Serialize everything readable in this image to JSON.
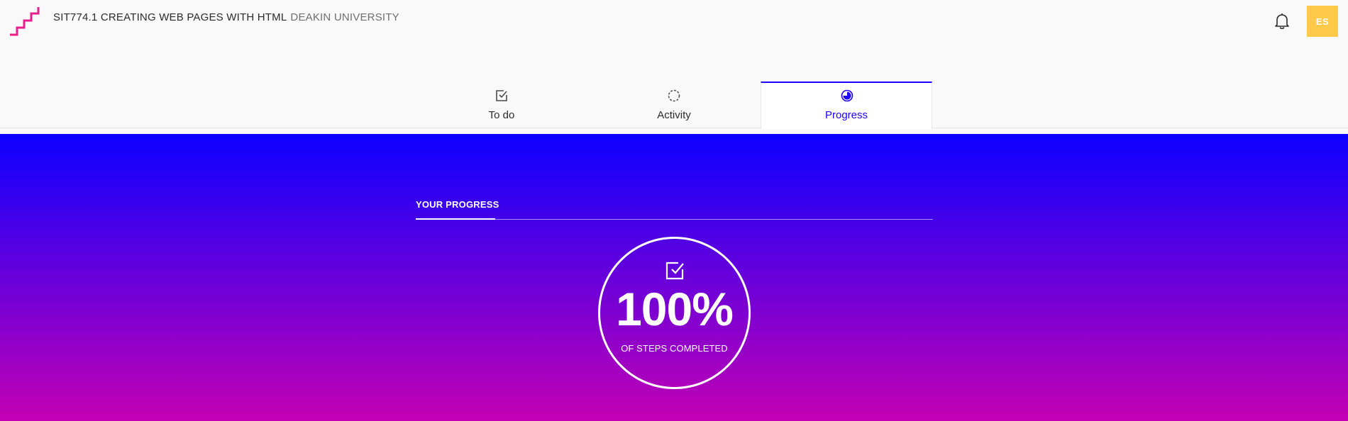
{
  "header": {
    "course_code_title": "SIT774.1 CREATING WEB PAGES WITH HTML",
    "university": "DEAKIN UNIVERSITY",
    "logo_icon": "staircase-logo-icon",
    "notification_icon": "bell-icon",
    "avatar_initials": "ES",
    "brand_color": "#e91e8c",
    "avatar_color": "#ffc94a"
  },
  "tabs": [
    {
      "label": "To do",
      "icon": "checkbox-icon",
      "active": false
    },
    {
      "label": "Activity",
      "icon": "dashed-circle-icon",
      "active": false
    },
    {
      "label": "Progress",
      "icon": "progress-circle-icon",
      "active": true
    }
  ],
  "accent_color": "#1d00ff",
  "progress": {
    "heading": "YOUR PROGRESS",
    "percent_text": "100%",
    "percent_value": 100,
    "caption": "OF STEPS COMPLETED",
    "icon": "checkbox-icon",
    "gradient_top": "#0b00ff",
    "gradient_bottom": "#c300b3"
  }
}
